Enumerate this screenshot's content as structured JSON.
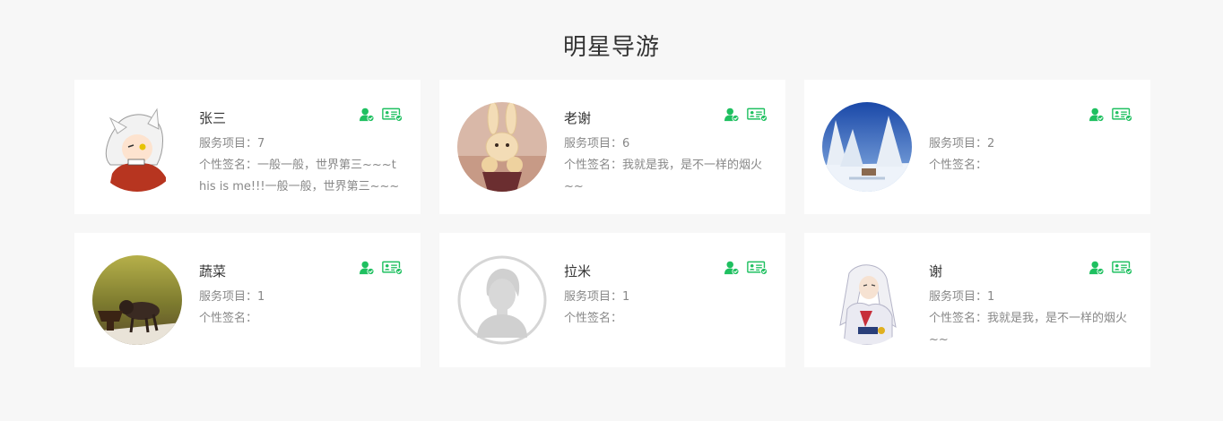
{
  "page": {
    "title": "明星导游"
  },
  "labels": {
    "service_prefix": "服务项目：",
    "signature_prefix": "个性签名："
  },
  "colors": {
    "accent": "#1fc060",
    "background": "#f7f7f7"
  },
  "guides": [
    {
      "name": "张三",
      "service_count": "7",
      "signature": "一般一般，世界第三~~~this is me!!!一般一般，世界第三~~~thi",
      "avatar": "anime-white-hair-boy"
    },
    {
      "name": "老谢",
      "service_count": "6",
      "signature": "我就是我，是不一样的烟火~~",
      "avatar": "bunny-pastry"
    },
    {
      "name": "",
      "service_count": "2",
      "signature": "",
      "avatar": "snowy-landscape"
    },
    {
      "name": "蔬菜",
      "service_count": "1",
      "signature": "",
      "avatar": "cat-in-grass"
    },
    {
      "name": "拉米",
      "service_count": "1",
      "signature": "",
      "avatar": "default-avatar"
    },
    {
      "name": "谢",
      "service_count": "1",
      "signature": "我就是我，是不一样的烟火~~",
      "avatar": "anime-white-hair-man"
    }
  ],
  "icons": {
    "verified_user": "verified-user-icon",
    "verified_id": "verified-id-card-icon"
  }
}
